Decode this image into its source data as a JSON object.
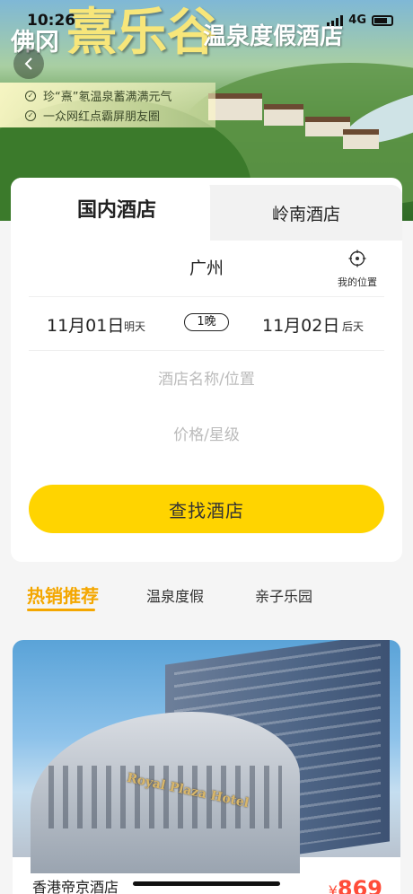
{
  "status_bar": {
    "time": "10:26",
    "network": "4G"
  },
  "banner": {
    "title_left": "佛冈",
    "title_main": "熹乐谷",
    "title_right": "温泉度假酒店",
    "slogans": [
      "珍“熹”氡温泉蓄满满元气",
      "一众网红点霸屏朋友圈"
    ]
  },
  "tabs": {
    "active": "国内酒店",
    "inactive": "岭南酒店"
  },
  "search": {
    "city": "广州",
    "locate_label": "我的位置",
    "checkin_date": "11月01日",
    "checkin_tag": "明天",
    "nights": "1晚",
    "checkout_date": "11月02日",
    "checkout_tag": "后天",
    "keyword_placeholder": "酒店名称/位置",
    "price_placeholder": "价格/星级",
    "button": "查找酒店"
  },
  "categories": [
    "热销推荐",
    "温泉度假",
    "亲子乐园"
  ],
  "hotel": {
    "name": "香港帝京酒店",
    "price_currency": "¥",
    "price": "869",
    "sign_text": "Royal Plaza Hotel"
  },
  "colors": {
    "accent": "#ffd400",
    "category_active": "#f4a700",
    "price": "#ff4d3a"
  }
}
